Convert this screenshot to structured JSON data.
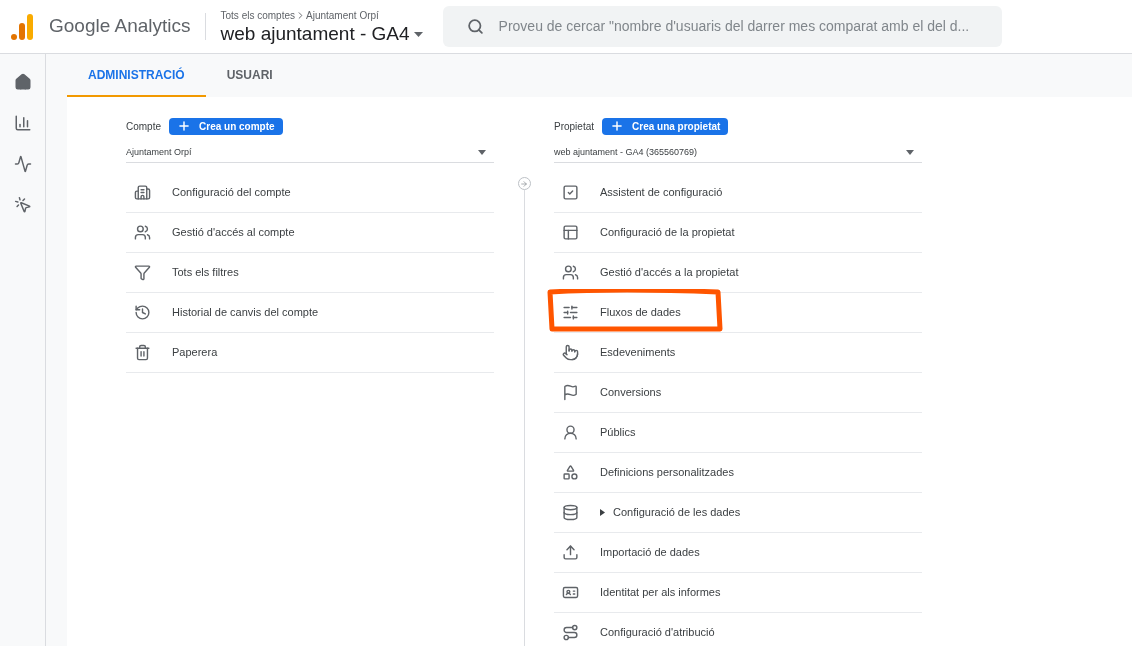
{
  "header": {
    "product": "Google Analytics",
    "breadcrumb": [
      "Tots els comptes",
      "Ajuntament Orpí"
    ],
    "property": "web ajuntament - GA4",
    "search": {
      "placeholder": "Proveu de cercar \"nombre d'usuaris del darrer mes comparat amb el del d..."
    }
  },
  "tabs": [
    {
      "label": "ADMINISTRACIÓ",
      "selected": true
    },
    {
      "label": "USUARI",
      "selected": false
    }
  ],
  "account": {
    "label": "Compte",
    "button": "Crea un compte",
    "selector": "Ajuntament Orpí",
    "items": [
      {
        "label": "Configuració del compte"
      },
      {
        "label": "Gestió d'accés al compte"
      },
      {
        "label": "Tots els filtres"
      },
      {
        "label": "Historial de canvis del compte"
      },
      {
        "label": "Paperera"
      }
    ]
  },
  "property": {
    "label": "Propietat",
    "button": "Crea una propietat",
    "selector": "web ajuntament - GA4 (365560769)",
    "items": [
      {
        "label": "Assistent de configuració",
        "highlighted": false
      },
      {
        "label": "Configuració de la propietat",
        "highlighted": false
      },
      {
        "label": "Gestió d'accés a la propietat",
        "highlighted": false
      },
      {
        "label": "Fluxos de dades",
        "highlighted": true
      },
      {
        "label": "Esdeveniments",
        "highlighted": false
      },
      {
        "label": "Conversions",
        "highlighted": false
      },
      {
        "label": "Públics",
        "highlighted": false
      },
      {
        "label": "Definicions personalitzades",
        "highlighted": false
      },
      {
        "label": "Configuració de les dades",
        "highlighted": false,
        "expanded": false
      },
      {
        "label": "Importació de dades",
        "highlighted": false
      },
      {
        "label": "Identitat per als informes",
        "highlighted": false
      },
      {
        "label": "Configuració d'atribució",
        "highlighted": false
      }
    ]
  }
}
